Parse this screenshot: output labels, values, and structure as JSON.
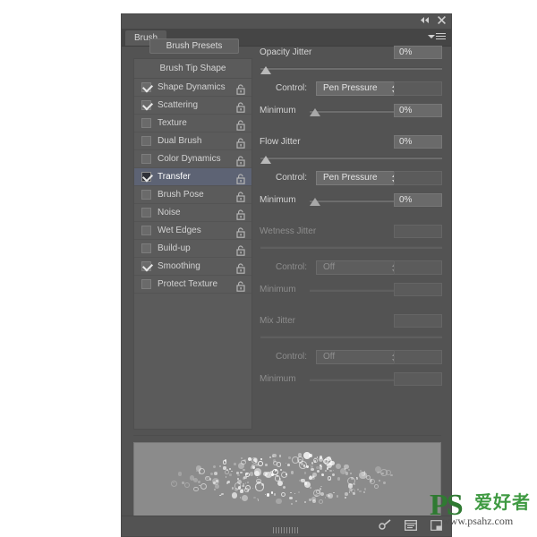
{
  "window": {
    "title": "Brush",
    "collapse_icon": "collapse-left-icon",
    "close_icon": "close-icon",
    "panel_menu_icon": "panel-menu-icon"
  },
  "tabs": [
    {
      "label": "Brush",
      "active": true
    }
  ],
  "left_panel": {
    "presets_button": "Brush Presets",
    "header": "Brush Tip Shape",
    "options": [
      {
        "label": "Shape Dynamics",
        "checked": true,
        "selected": false,
        "lock": "unlocked-icon"
      },
      {
        "label": "Scattering",
        "checked": true,
        "selected": false,
        "lock": "unlocked-icon"
      },
      {
        "label": "Texture",
        "checked": false,
        "selected": false,
        "lock": "unlocked-icon"
      },
      {
        "label": "Dual Brush",
        "checked": false,
        "selected": false,
        "lock": "unlocked-icon"
      },
      {
        "label": "Color Dynamics",
        "checked": false,
        "selected": false,
        "lock": "unlocked-icon"
      },
      {
        "label": "Transfer",
        "checked": true,
        "selected": true,
        "lock": "unlocked-icon"
      },
      {
        "label": "Brush Pose",
        "checked": false,
        "selected": false,
        "lock": "unlocked-icon"
      },
      {
        "label": "Noise",
        "checked": false,
        "selected": false,
        "lock": "unlocked-icon"
      },
      {
        "label": "Wet Edges",
        "checked": false,
        "selected": false,
        "lock": "unlocked-icon"
      },
      {
        "label": "Build-up",
        "checked": false,
        "selected": false,
        "lock": "unlocked-icon"
      },
      {
        "label": "Smoothing",
        "checked": true,
        "selected": false,
        "lock": "unlocked-icon"
      },
      {
        "label": "Protect Texture",
        "checked": false,
        "selected": false,
        "lock": "unlocked-icon"
      }
    ]
  },
  "right_panel": {
    "control_label": "Control:",
    "minimum_label": "Minimum",
    "groups": [
      {
        "title": "Opacity Jitter",
        "value": "0%",
        "slider_percent": 0,
        "control_value": "Pen Pressure",
        "minimum_value": "0%",
        "minimum_percent": 0,
        "enabled": true
      },
      {
        "title": "Flow Jitter",
        "value": "0%",
        "slider_percent": 0,
        "control_value": "Pen Pressure",
        "minimum_value": "0%",
        "minimum_percent": 0,
        "enabled": true
      },
      {
        "title": "Wetness Jitter",
        "value": "",
        "slider_percent": 0,
        "control_value": "Off",
        "minimum_value": "",
        "minimum_percent": 0,
        "enabled": false
      },
      {
        "title": "Mix Jitter",
        "value": "",
        "slider_percent": 0,
        "control_value": "Off",
        "minimum_value": "",
        "minimum_percent": 0,
        "enabled": false
      }
    ]
  },
  "preview": {
    "name": "brush-stroke-preview"
  },
  "footer": {
    "tools": [
      {
        "name": "brush-tool-icon"
      },
      {
        "name": "brush-panel-icon"
      },
      {
        "name": "new-brush-icon"
      }
    ],
    "resize_grip": "resize-grip"
  },
  "watermark": {
    "logo": "PS",
    "chinese": "爱好者",
    "url": "www.psahz.com",
    "color": "#2f7a32"
  },
  "colors": {
    "panel_bg": "#535353",
    "list_bg": "#5b5b5b",
    "selection": "#5d6374",
    "text": "#d3d3d3",
    "disabled_text": "#8d8d8d",
    "preview_bg": "#8b8b8b"
  }
}
